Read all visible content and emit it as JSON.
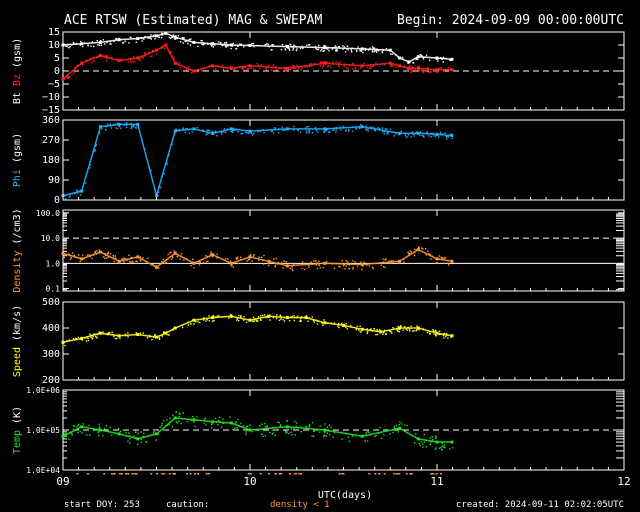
{
  "header": {
    "title": "ACE RTSW (Estimated) MAG & SWEPAM",
    "begin": "Begin: 2024-09-09 00:00:00UTC"
  },
  "footer": {
    "start_doy": "start DOY: 253",
    "caution": "caution:",
    "density_note": "density < 1",
    "created": "created: 2024-09-11 02:02:05UTC"
  },
  "colors": {
    "background": "#000000",
    "axes": "#ffffff",
    "bt": "#ffffff",
    "bz": "#ff2020",
    "phi": "#20b0ff",
    "density": "#ff9a30",
    "speed": "#ffff20",
    "temp": "#20e020",
    "flag": "#ff9a30"
  },
  "chart_data": {
    "type": "scatter",
    "xlabel": "UTC(days)",
    "x_ticks": [
      "09",
      "10",
      "11",
      "12"
    ],
    "xlim": [
      9,
      12
    ],
    "data_end_day": 11.08,
    "panels": [
      {
        "id": "magnetic",
        "ylabel_parts": [
          "Bt",
          "Bz",
          "(gsm)"
        ],
        "ylim": [
          -15,
          15
        ],
        "yticks": [
          15,
          10,
          5,
          0,
          -5,
          -10,
          -15
        ],
        "ytick_labels": [
          "15",
          "10",
          "5",
          "0",
          "−5",
          "−10",
          "−15"
        ],
        "dashed_lines": [
          0
        ],
        "series": [
          {
            "name": "Bt",
            "color": "bt",
            "x": [
              9.0,
              9.1,
              9.2,
              9.3,
              9.4,
              9.5,
              9.55,
              9.6,
              9.7,
              9.8,
              9.9,
              10.0,
              10.2,
              10.4,
              10.6,
              10.75,
              10.8,
              10.85,
              10.9,
              11.0,
              11.08
            ],
            "y": [
              10,
              10.5,
              11,
              12,
              12.5,
              13.5,
              14.5,
              13,
              11,
              10.5,
              10,
              9.8,
              9.4,
              9,
              8.5,
              8,
              5,
              3.5,
              5.5,
              5,
              4.5
            ]
          },
          {
            "name": "Bz",
            "color": "bz",
            "x": [
              9.0,
              9.1,
              9.2,
              9.3,
              9.4,
              9.5,
              9.55,
              9.6,
              9.7,
              9.8,
              9.9,
              10.0,
              10.2,
              10.4,
              10.6,
              10.75,
              10.8,
              10.85,
              10.9,
              11.0,
              11.08
            ],
            "y": [
              -3,
              3,
              6,
              4,
              5,
              8,
              10,
              3,
              0,
              2,
              1,
              2,
              1,
              3,
              2,
              3,
              2,
              1,
              1,
              0.5,
              0.5
            ]
          }
        ]
      },
      {
        "id": "phi",
        "ylabel_parts": [
          "Phi",
          "(gsm)"
        ],
        "ylim": [
          0,
          360
        ],
        "yticks": [
          360,
          270,
          180,
          90,
          0
        ],
        "ytick_labels": [
          "360",
          "270",
          "180",
          "90",
          "0"
        ],
        "dashed_lines": [],
        "series": [
          {
            "name": "Phi",
            "color": "phi",
            "x": [
              9.0,
              9.1,
              9.2,
              9.3,
              9.4,
              9.5,
              9.6,
              9.7,
              9.8,
              9.9,
              10.0,
              10.2,
              10.4,
              10.6,
              10.8,
              10.9,
              11.0,
              11.08
            ],
            "y": [
              20,
              40,
              330,
              340,
              340,
              20,
              310,
              320,
              300,
              320,
              310,
              320,
              320,
              330,
              300,
              300,
              295,
              290
            ]
          }
        ]
      },
      {
        "id": "density",
        "ylabel_parts": [
          "Density",
          "(/cm3)"
        ],
        "log": true,
        "ylim": [
          0.08,
          130
        ],
        "yticks": [
          100,
          10,
          1,
          0.1
        ],
        "ytick_labels": [
          "100.0",
          "10.0",
          "1.0",
          "0.1"
        ],
        "dashed_lines": [
          10
        ],
        "solid_lines": [
          1
        ],
        "series": [
          {
            "name": "Density",
            "color": "density",
            "x": [
              9.0,
              9.1,
              9.2,
              9.3,
              9.4,
              9.5,
              9.6,
              9.7,
              9.8,
              9.9,
              10.0,
              10.2,
              10.4,
              10.6,
              10.8,
              10.9,
              11.0,
              11.08
            ],
            "y": [
              2.5,
              1.5,
              2.8,
              1.2,
              1.8,
              0.7,
              2.5,
              1.0,
              2.2,
              1.0,
              1.8,
              0.8,
              1.0,
              0.9,
              1.2,
              3.5,
              1.5,
              1.2
            ]
          }
        ]
      },
      {
        "id": "speed",
        "ylabel_parts": [
          "Speed",
          "(km/s)"
        ],
        "ylim": [
          200,
          500
        ],
        "yticks": [
          500,
          400,
          300,
          200
        ],
        "ytick_labels": [
          "500",
          "400",
          "300",
          "200"
        ],
        "dashed_lines": [],
        "series": [
          {
            "name": "Speed",
            "color": "speed",
            "x": [
              9.0,
              9.1,
              9.2,
              9.3,
              9.4,
              9.5,
              9.55,
              9.6,
              9.7,
              9.8,
              9.9,
              10.0,
              10.1,
              10.2,
              10.3,
              10.4,
              10.5,
              10.6,
              10.7,
              10.8,
              10.9,
              11.0,
              11.08
            ],
            "y": [
              345,
              360,
              380,
              370,
              375,
              365,
              380,
              400,
              430,
              440,
              445,
              430,
              445,
              440,
              440,
              420,
              410,
              395,
              385,
              400,
              400,
              380,
              370
            ]
          }
        ]
      },
      {
        "id": "temp",
        "ylabel_parts": [
          "Temp",
          "(K)"
        ],
        "log": true,
        "ylim": [
          10000,
          1000000
        ],
        "yticks": [
          1000000,
          100000,
          10000
        ],
        "ytick_labels": [
          "1.0E+06",
          "1.0E+05",
          "1.0E+04"
        ],
        "dashed_lines": [
          100000
        ],
        "series": [
          {
            "name": "Temp",
            "color": "temp",
            "x": [
              9.0,
              9.1,
              9.2,
              9.3,
              9.4,
              9.5,
              9.6,
              9.7,
              9.8,
              9.9,
              10.0,
              10.2,
              10.4,
              10.6,
              10.8,
              10.9,
              11.0,
              11.08
            ],
            "y": [
              70000,
              120000,
              100000,
              80000,
              60000,
              80000,
              200000,
              180000,
              160000,
              150000,
              100000,
              120000,
              100000,
              70000,
              110000,
              60000,
              50000,
              50000
            ]
          }
        ]
      }
    ]
  }
}
